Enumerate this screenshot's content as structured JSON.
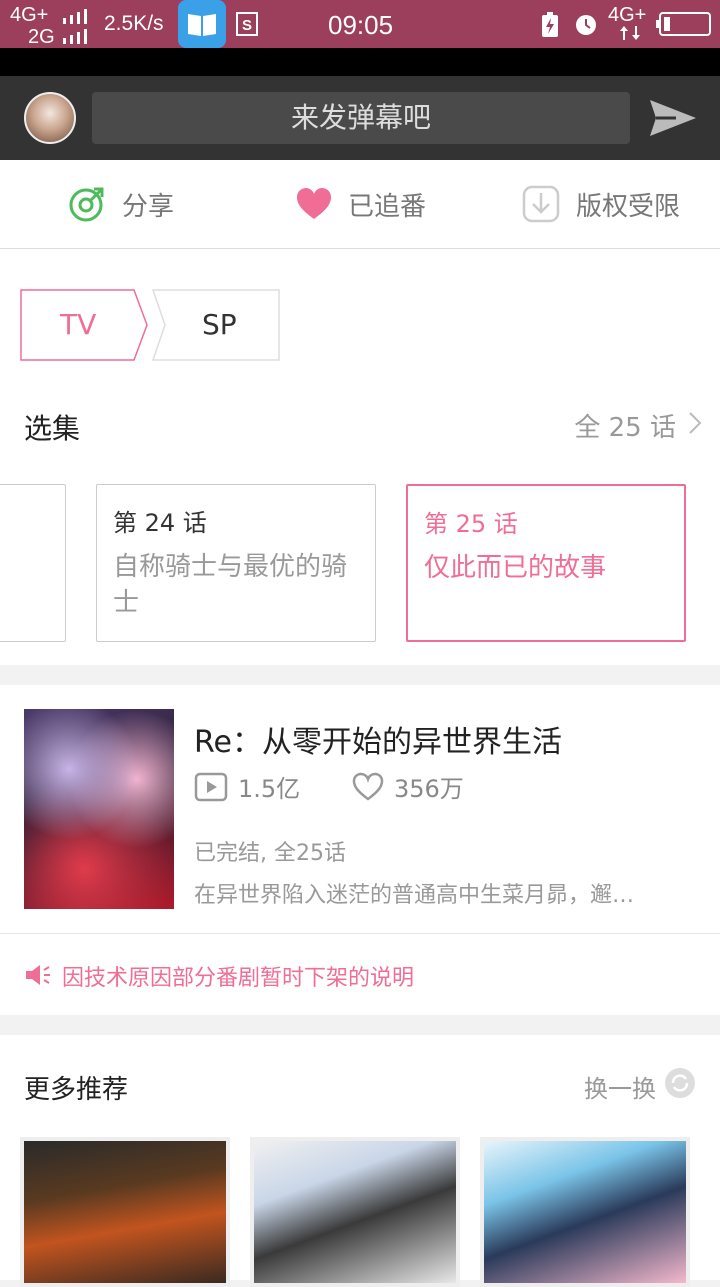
{
  "status_bar": {
    "net1": "4G+",
    "net2": "2G",
    "speed": "2.5K/s",
    "time": "09:05",
    "net_right": "4G+"
  },
  "danmu": {
    "placeholder": "来发弹幕吧"
  },
  "actions": {
    "share": "分享",
    "follow": "已追番",
    "download": "版权受限"
  },
  "season_tabs": [
    "TV",
    "SP"
  ],
  "episodes": {
    "section_title": "选集",
    "total": "全 25 话",
    "items": [
      {
        "num": "第 24 话",
        "name": "自称骑士与最优的骑士",
        "active": false
      },
      {
        "num": "第 25 话",
        "name": "仅此而已的故事",
        "active": true
      }
    ]
  },
  "series": {
    "title": "Re：从零开始的异世界生活",
    "plays": "1.5亿",
    "likes": "356万",
    "status": "已完结, 全25话",
    "description": "在异世界陷入迷茫的普通高中生菜月昴，邂…",
    "notice": "因技术原因部分番剧暂时下架的说明"
  },
  "recommend": {
    "title": "更多推荐",
    "refresh": "换一换"
  },
  "colors": {
    "accent": "#f06d95",
    "statusbar": "#9b3f5c",
    "share_green": "#4cbc5a"
  }
}
